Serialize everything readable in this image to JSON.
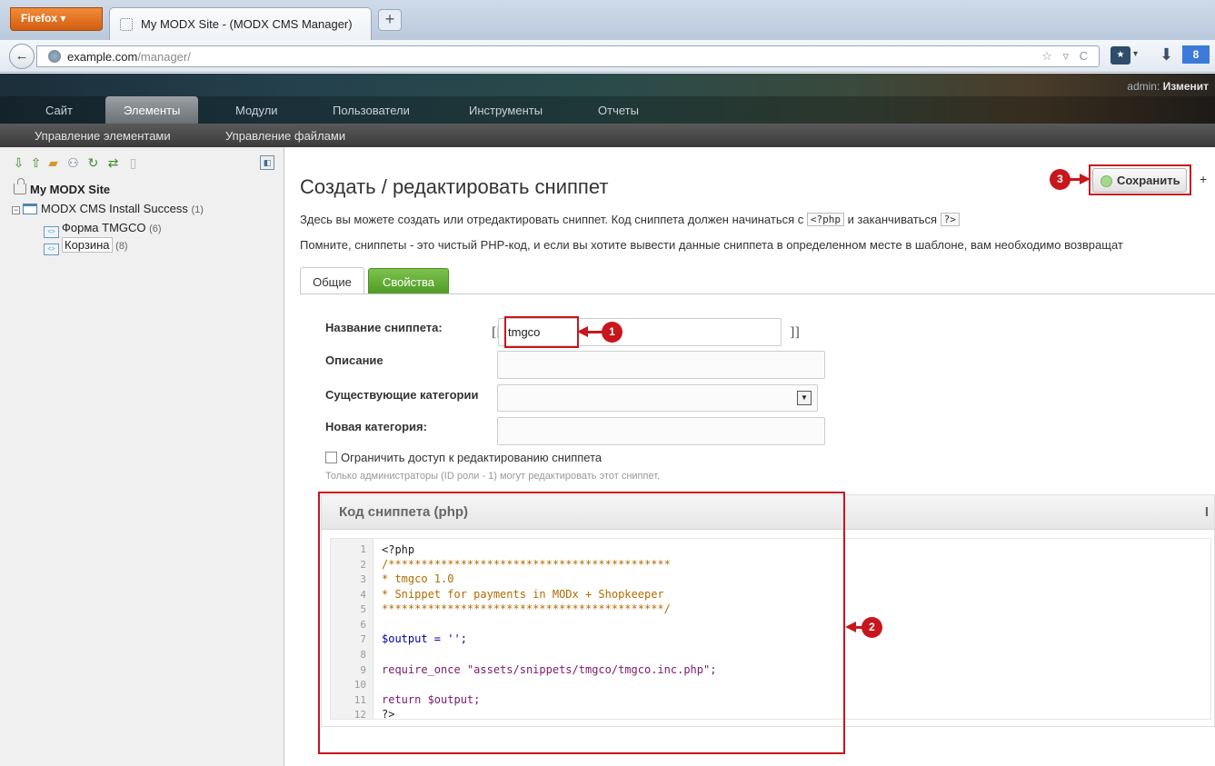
{
  "browser": {
    "menu_label": "Firefox ▾",
    "tab_title": "My MODX Site - (MODX CMS Manager)",
    "new_tab": "+",
    "back": "←",
    "url_host": "example.com",
    "url_path": "/manager/",
    "url_icons": "☆ ▿ C",
    "ext_google": "8"
  },
  "header": {
    "admin_prefix": "admin: ",
    "admin_action": "Изменит",
    "nav": [
      {
        "label": "Сайт"
      },
      {
        "label": "Элементы",
        "active": true
      },
      {
        "label": "Модули"
      },
      {
        "label": "Пользователи"
      },
      {
        "label": "Инструменты"
      },
      {
        "label": "Отчеты"
      }
    ],
    "subnav": [
      {
        "label": "Управление элементами"
      },
      {
        "label": "Управление файлами"
      }
    ]
  },
  "tree": {
    "root": "My MODX Site",
    "category": {
      "label": "MODX CMS Install Success",
      "count": "(1)"
    },
    "items": [
      {
        "label": "Форма TMGCO",
        "count": "(6)"
      },
      {
        "label": "Корзина",
        "count": "(8)"
      }
    ]
  },
  "page": {
    "title": "Создать / редактировать сниппет",
    "desc1_pre": "Здесь вы можете создать или отредактировать сниппет. Код сниппета должен начинаться с ",
    "desc1_tag1": "<?php",
    "desc1_mid": " и заканчиваться ",
    "desc1_tag2": "?>",
    "desc2": "Помните, сниппеты - это чистый PHP-код, и если вы хотите вывести данные сниппета в определенном месте в шаблоне, вам необходимо возвращат",
    "save_label": "Сохранить",
    "more_label": "+"
  },
  "tabs": [
    {
      "label": "Общие",
      "active": true
    },
    {
      "label": "Свойства"
    }
  ],
  "form": {
    "name_label": "Название сниппета:",
    "name_value": "tmgco",
    "bracket_open": "[[",
    "bracket_close": "]]",
    "desc_label": "Описание",
    "desc_value": "",
    "cat_label": "Существующие категории",
    "cat_value": "",
    "newcat_label": "Новая категория:",
    "newcat_value": "",
    "lock_label": "Ограничить доступ к редактированию сниппета",
    "lock_checked": false,
    "lock_hint": "Только администраторы (ID роли - 1) могут редактировать этот сниппет."
  },
  "code": {
    "title": "Код сниппета (php)",
    "more": "I",
    "lines": [
      {
        "n": "1",
        "text": "<?php",
        "cls": ""
      },
      {
        "n": "2",
        "text": "/*******************************************",
        "cls": "cmt"
      },
      {
        "n": "3",
        "text": "* tmgco 1.0",
        "cls": "cmt"
      },
      {
        "n": "4",
        "text": "* Snippet for payments in MODx + Shopkeeper",
        "cls": "cmt"
      },
      {
        "n": "5",
        "text": "*******************************************/",
        "cls": "cmt"
      },
      {
        "n": "6",
        "text": "",
        "cls": ""
      },
      {
        "n": "7",
        "text": "$output = '';",
        "cls": "var"
      },
      {
        "n": "8",
        "text": "",
        "cls": ""
      },
      {
        "n": "9",
        "text": "require_once \"assets/snippets/tmgco/tmgco.inc.php\";",
        "cls": "fn"
      },
      {
        "n": "10",
        "text": "",
        "cls": ""
      },
      {
        "n": "11",
        "text": "return $output;",
        "cls": "fn"
      },
      {
        "n": "12",
        "text": "?>",
        "cls": ""
      }
    ]
  },
  "annotations": {
    "badge1": "1",
    "badge2": "2",
    "badge3": "3",
    "color": "#c8161d"
  },
  "colors": {
    "tab_active_green": "#5aa72f",
    "firefox_orange": "#e07020",
    "nav_active": "#8a9094"
  }
}
